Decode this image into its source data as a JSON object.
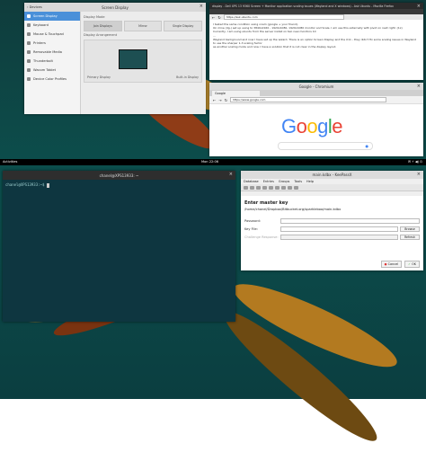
{
  "topbar": {
    "activities": "Activities",
    "clock": "Mon 22:06",
    "tray": "✉ ⚡ ◀) ⏻"
  },
  "settings": {
    "title": "Screen Display",
    "back_label": "Devices",
    "sidebar": [
      "Screen Display",
      "Keyboard",
      "Mouse & Touchpad",
      "Printers",
      "Removable Media",
      "Thunderbolt",
      "Wacom Tablet",
      "Device Color Profiles"
    ],
    "display_mode_label": "Display Mode",
    "modes": [
      "Join Displays",
      "Mirror",
      "Single Display"
    ],
    "arrangement_label": "Display Arrangement",
    "primary_label": "Primary Display",
    "builtin_label": "Built-in Display"
  },
  "browser1": {
    "title": "display - Dell XPS 13 9360 Screen + Monitor application scaling issues (Wayland and X windows) - Ask Ubuntu - Mozilla Firefox",
    "address": "https://ask.ubuntu.com",
    "lines": [
      "I tested the same condition using vnam (google + your friend).",
      "On mine (dg-) set up using to 3840x2160 - 1920x1080, 1920x1080 monitor and Scale. I am use this externally with pivot on next right: (1x)",
      "Currently, I am using ubuntu from the server install on two new monitors 10",
      "...",
      "Wayland background and now I have set up the wizard. There is an option Screen Display and the X11 - they didn't fix some scaling issues in Wayland to use the sharper 1-3 scaling factor",
      "as another scaling mode and now. I have a solution that it is not clear in the display layout."
    ]
  },
  "browser2": {
    "title": "Google - Chromium",
    "tab": "Google",
    "address": "https://www.google.com",
    "logo": [
      "G",
      "o",
      "o",
      "g",
      "l",
      "e"
    ],
    "logo_colors": [
      "#4285f4",
      "#ea4335",
      "#fbbc05",
      "#4285f4",
      "#34a853",
      "#ea4335"
    ]
  },
  "terminal": {
    "title": "chanel@XPS13933: ~",
    "prompt": "chanel@XPS13933:~$ "
  },
  "keepass": {
    "title": "main.kdbx - KeePassX",
    "menu": [
      "Database",
      "Entries",
      "Groups",
      "Tools",
      "Help"
    ],
    "heading": "Enter master key",
    "path": "/home/chanel/Dropbox/Bitbucket.org/sparkleboo/main.kdbx",
    "password_label": "Password:",
    "keyfile_label": "Key File:",
    "browse_label": "Browse",
    "refresh_label": "Refresh",
    "challenge_label": "Challenge Response:",
    "cancel_label": "Cancel",
    "ok_label": "OK"
  }
}
